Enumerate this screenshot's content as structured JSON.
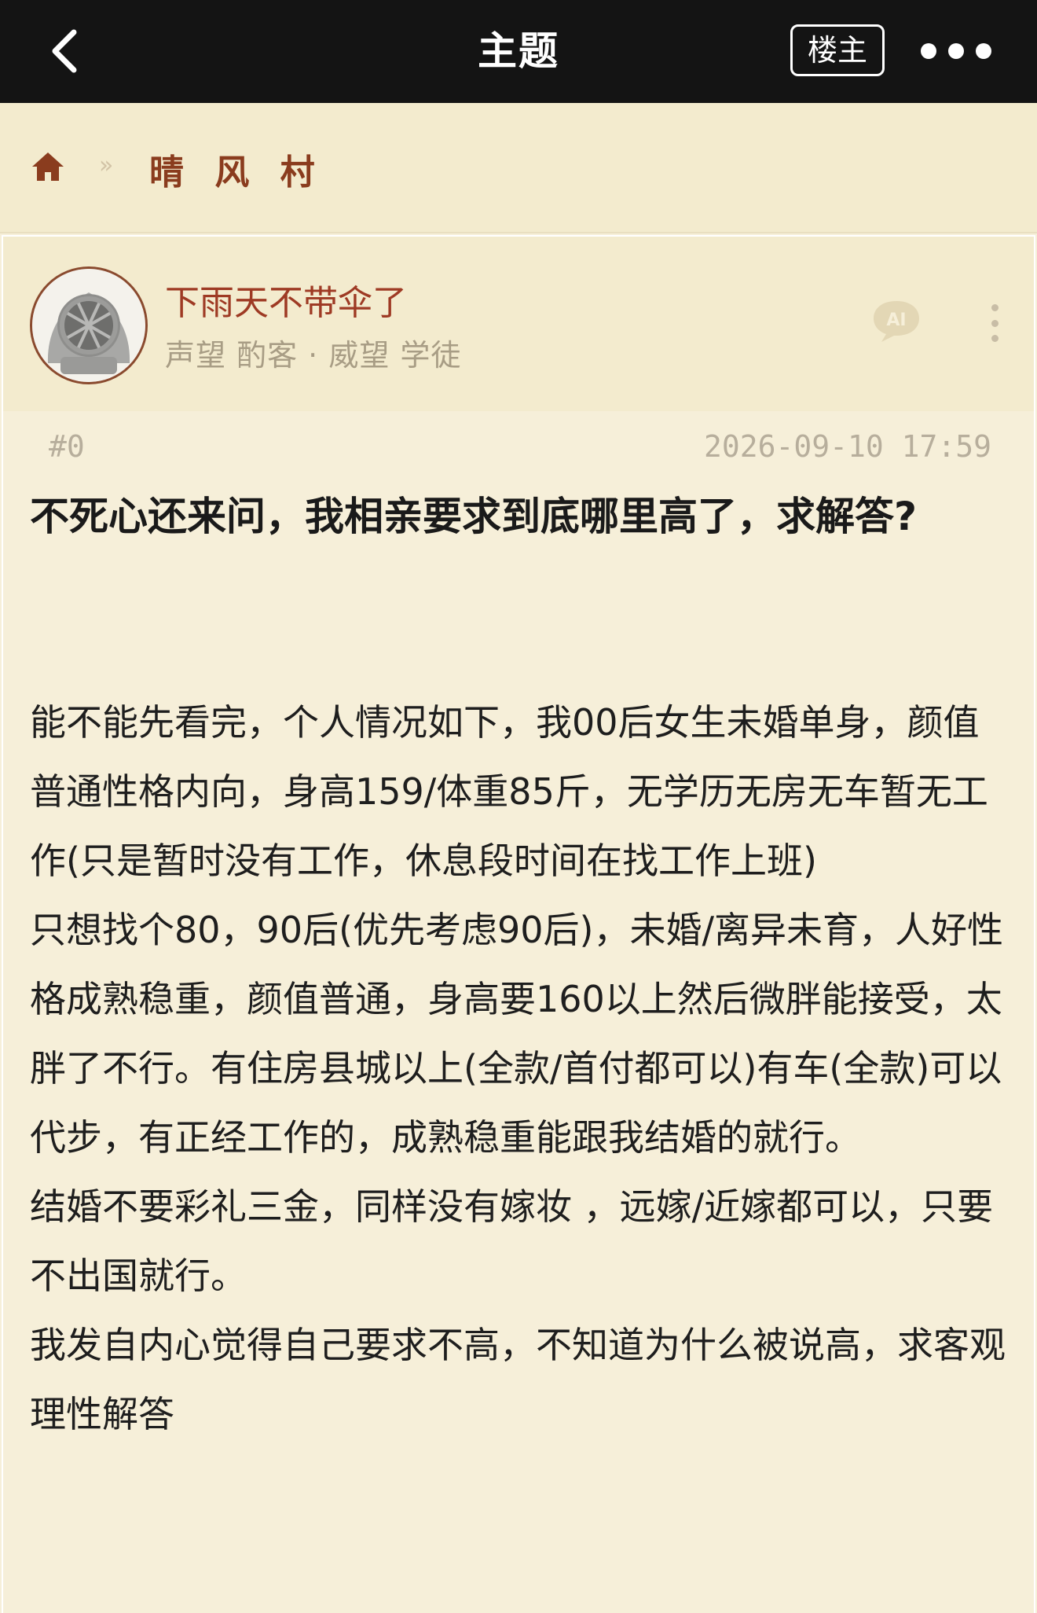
{
  "header": {
    "title": "主题",
    "op_label": "楼主"
  },
  "breadcrumb": {
    "forum_name": "晴 风 村",
    "separator": "»"
  },
  "post": {
    "author": {
      "name": "下雨天不带伞了",
      "meta": "声望 酌客 · 威望 学徒"
    },
    "floor": "#0",
    "timestamp": "2026-09-10 17:59",
    "title": "不死心还来问，我相亲要求到底哪里高了，求解答?",
    "body": [
      "能不能先看完，个人情况如下，我00后女生未婚单身，颜值普通性格内向，身高159/体重85斤，无学历无房无车暂无工作(只是暂时没有工作，休息段时间在找工作上班)",
      "只想找个80，90后(优先考虑90后)，未婚/离异未育，人好性格成熟稳重，颜值普通，身高要160以上然后微胖能接受，太胖了不行。有住房县城以上(全款/首付都可以)有车(全款)可以代步，有正经工作的，成熟稳重能跟我结婚的就行。",
      "结婚不要彩礼三金，同样没有嫁妆 ，远嫁/近嫁都可以，只要不出国就行。",
      "我发自内心觉得自己要求不高，不知道为什么被说高，求客观理性解答"
    ]
  },
  "icons": {
    "back": "chevron-left-icon",
    "more": "more-dots-icon",
    "home": "home-icon",
    "ai": "ai-bubble-icon",
    "kebab": "kebab-icon"
  },
  "colors": {
    "topbar": "#141414",
    "background": "#F6EFD9",
    "breadcrumb_bg": "#F3EBCE",
    "accent_brown": "#8A3C1E",
    "author_red": "#9E3A24",
    "muted": "#A89D85"
  }
}
